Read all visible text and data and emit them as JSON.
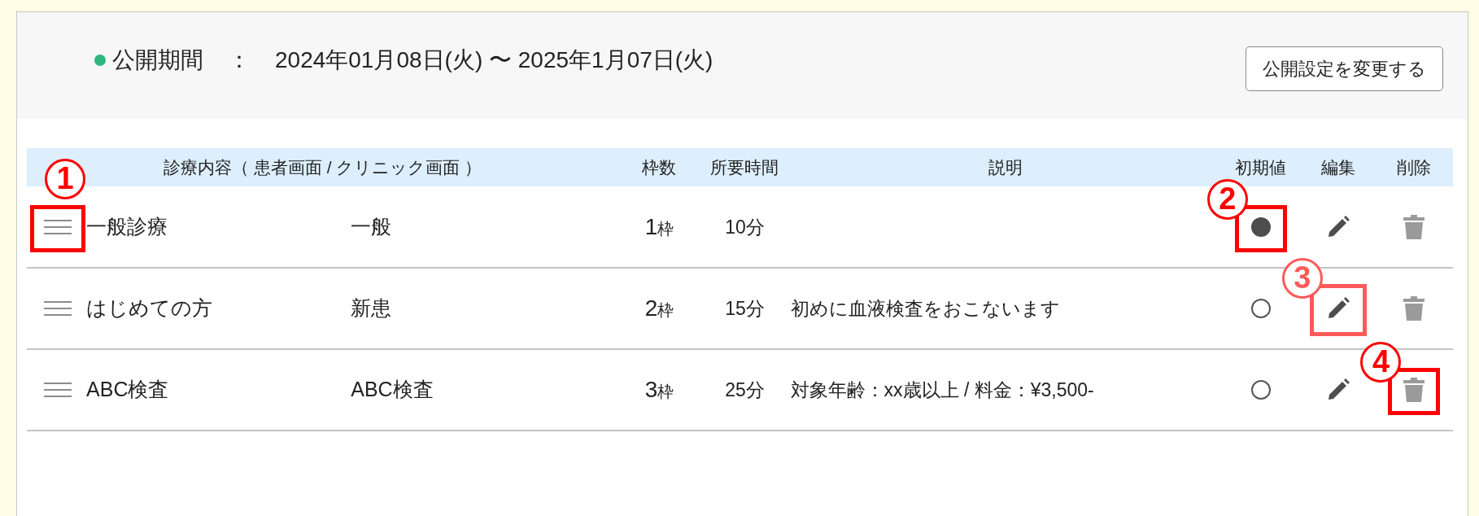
{
  "period": {
    "label": "公開期間",
    "separator": "：",
    "value": "2024年01月08日(火) 〜 2025年1月07日(火)"
  },
  "change_button": "公開設定を変更する",
  "table": {
    "columns": [
      {
        "kind": "name",
        "label": "診療内容（ 患者画面 / クリニック画面 ）"
      },
      {
        "kind": "slots",
        "label": "枠数"
      },
      {
        "kind": "time",
        "label": "所要時間"
      },
      {
        "kind": "desc",
        "label": "説明"
      },
      {
        "kind": "default",
        "label": "初期値"
      },
      {
        "kind": "edit",
        "label": "編集"
      },
      {
        "kind": "delete",
        "label": "削除"
      }
    ],
    "rows": [
      {
        "name": "一般診療",
        "short_name": "一般",
        "slots": "1",
        "slots_unit": "枠",
        "time": "10分",
        "description": "",
        "default": true,
        "handle_callout": {
          "label": "1",
          "color": "#ff0000"
        },
        "default_callout": {
          "label": "2",
          "color": "#ff0000"
        }
      },
      {
        "name": "はじめての方",
        "short_name": "新患",
        "slots": "2",
        "slots_unit": "枠",
        "time": "15分",
        "description": "初めに血液検査をおこないます",
        "default": false,
        "edit_callout": {
          "label": "3",
          "color": "#ff5a5a"
        }
      },
      {
        "name": "ABC検査",
        "short_name": "ABC検査",
        "slots": "3",
        "slots_unit": "枠",
        "time": "25分",
        "description": "対象年齢：xx歳以上 / 料金：¥3,500-",
        "default": false,
        "delete_callout": {
          "label": "4",
          "color": "#ff0000"
        }
      }
    ]
  }
}
